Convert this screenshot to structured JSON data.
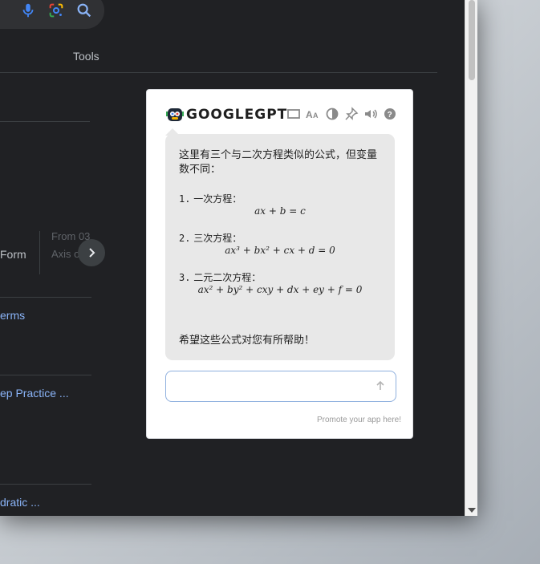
{
  "browser": {
    "tools_label": "Tools",
    "card": {
      "label": "Form",
      "sub_top": "From 03",
      "sub_bottom": "Axis o"
    },
    "links": [
      "erms",
      "ep Practice ...",
      "dratic ..."
    ]
  },
  "panel": {
    "logo_text": "GOOGLEGPT",
    "header_icons": [
      "window-icon",
      "font-size-icon",
      "contrast-icon",
      "pin-icon",
      "sound-icon",
      "help-icon"
    ],
    "answer": {
      "intro": "这里有三个与二次方程类似的公式，但变量数不同：",
      "items": [
        {
          "num": "1.",
          "label": "一次方程：",
          "formula": "ax + b = c"
        },
        {
          "num": "2.",
          "label": "三次方程：",
          "formula": "ax³ + bx² + cx + d = 0"
        },
        {
          "num": "3.",
          "label": "二元二次方程：",
          "formula": "ax² + by² + cxy + dx + ey + f = 0"
        }
      ],
      "outro": "希望这些公式对您有所帮助！"
    },
    "input": {
      "placeholder": ""
    },
    "promo": "Promote your app here!"
  },
  "colors": {
    "link": "#8ab4f8",
    "page_bg": "#202124",
    "bubble": "#e8e8e8"
  }
}
